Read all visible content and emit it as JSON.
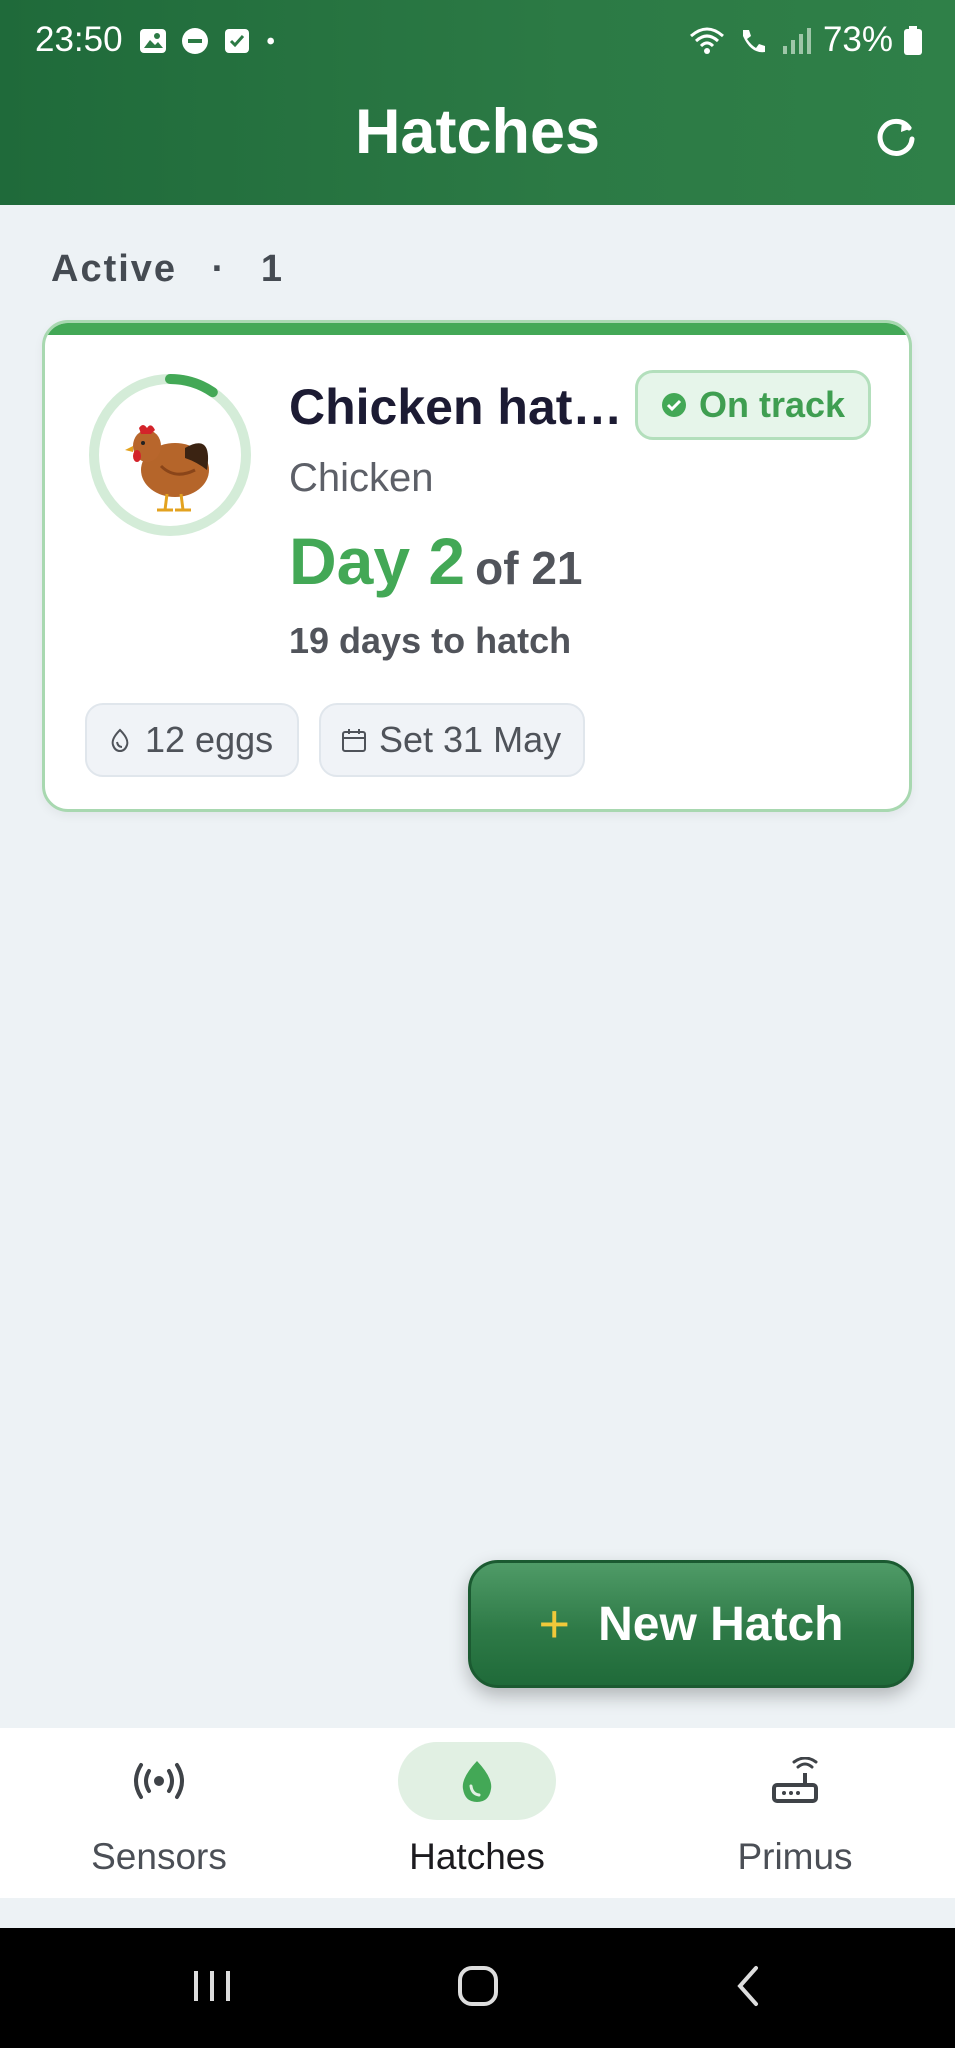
{
  "status_bar": {
    "time": "23:50",
    "battery": "73%",
    "icons_left": [
      "image-icon",
      "dnd-icon",
      "checkbox-icon",
      "dot-icon"
    ],
    "icons_right": [
      "wifi-icon",
      "wifi-call-icon",
      "signal-icon",
      "battery-icon"
    ]
  },
  "header": {
    "title": "Hatches"
  },
  "section": {
    "label": "Active",
    "separator": "·",
    "count": "1"
  },
  "hatch_card": {
    "name": "Chicken hat…",
    "species": "Chicken",
    "status": "On track",
    "day_label": "Day 2",
    "of_label": "of 21",
    "days_to_hatch": "19 days to hatch",
    "eggs": "12 eggs",
    "set_date": "Set 31 May",
    "progress": {
      "day": 2,
      "total_days": 21
    },
    "accent_color": "#43a856"
  },
  "fab": {
    "label": "New Hatch",
    "plus": "+"
  },
  "bottom_nav": [
    {
      "label": "Sensors",
      "icon": "sensor-icon",
      "active": false
    },
    {
      "label": "Hatches",
      "icon": "egg-icon",
      "active": true
    },
    {
      "label": "Primus",
      "icon": "router-icon",
      "active": false
    }
  ],
  "system_nav": [
    "recents-button",
    "home-button",
    "back-button"
  ]
}
